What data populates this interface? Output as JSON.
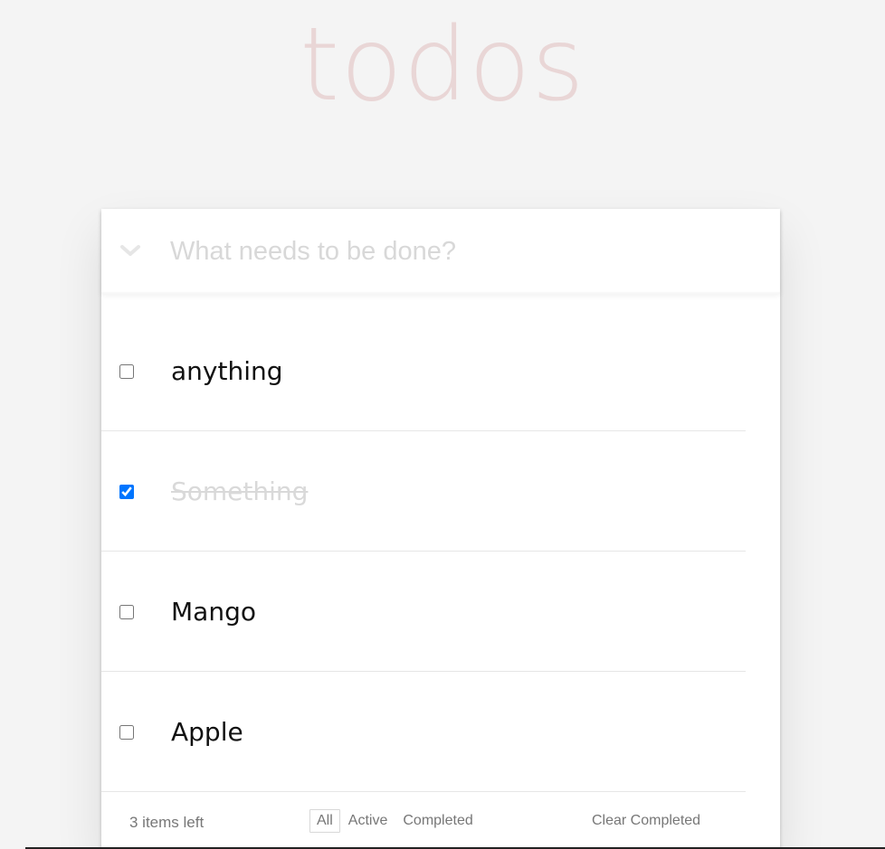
{
  "app": {
    "title": "todos"
  },
  "new_todo": {
    "placeholder": "What needs to be done?",
    "value": ""
  },
  "todos": [
    {
      "label": "anything",
      "completed": false
    },
    {
      "label": "Something",
      "completed": true
    },
    {
      "label": "Mango",
      "completed": false
    },
    {
      "label": "Apple",
      "completed": false
    }
  ],
  "footer": {
    "count_text": "3 items left",
    "filters": [
      {
        "label": "All",
        "selected": true
      },
      {
        "label": "Active",
        "selected": false
      },
      {
        "label": "Completed",
        "selected": false
      }
    ],
    "clear_label": "Clear Completed"
  },
  "icons": {
    "toggle_all": "chevron-down-icon"
  },
  "colors": {
    "title": "#efd5d5",
    "checkbox_accent": "#0075ff",
    "background": "#f4f4f4"
  }
}
